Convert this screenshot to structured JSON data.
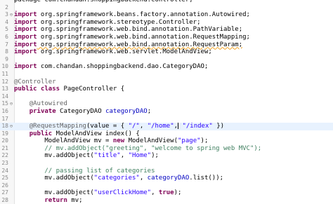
{
  "editor": {
    "lines": [
      {
        "num": "",
        "marker": "",
        "segments": [
          {
            "t": "package com.chandan.shoppingbackend.controller;",
            "k": "plain"
          }
        ]
      },
      {
        "num": "2",
        "marker": "",
        "segments": []
      },
      {
        "num": "3",
        "marker": "⊖",
        "segments": [
          {
            "t": "import",
            "k": "kw"
          },
          {
            "t": " org.springframework.beans.factory.annotation.Autowired;",
            "k": "plain"
          }
        ]
      },
      {
        "num": "4",
        "marker": "",
        "segments": [
          {
            "t": "import",
            "k": "kw"
          },
          {
            "t": " org.springframework.stereotype.Controller;",
            "k": "plain"
          }
        ]
      },
      {
        "num": "5",
        "marker": "",
        "segments": [
          {
            "t": "import",
            "k": "kw"
          },
          {
            "t": " org.springframework.web.bind.annotation.PathVariable;",
            "k": "plain"
          }
        ]
      },
      {
        "num": "6",
        "marker": "",
        "segments": [
          {
            "t": "import",
            "k": "kw"
          },
          {
            "t": " org.springframework.web.bind.annotation.RequestMapping;",
            "k": "plain"
          }
        ]
      },
      {
        "num": "7",
        "marker": "",
        "segments": [
          {
            "t": "import",
            "k": "kw"
          },
          {
            "t": " org.springframework.web.bind.annotation.RequestParam;",
            "k": "warn"
          }
        ]
      },
      {
        "num": "8",
        "marker": "",
        "segments": [
          {
            "t": "import",
            "k": "kw"
          },
          {
            "t": " org.springframework.web.servlet.ModelAndView;",
            "k": "plain"
          }
        ]
      },
      {
        "num": "9",
        "marker": "",
        "segments": []
      },
      {
        "num": "10",
        "marker": "",
        "segments": [
          {
            "t": "import",
            "k": "kw"
          },
          {
            "t": " com.chandan.shoppingbackend.dao.CategoryDAO;",
            "k": "plain"
          }
        ]
      },
      {
        "num": "11",
        "marker": "",
        "segments": []
      },
      {
        "num": "12",
        "marker": "",
        "segments": [
          {
            "t": "@Controller",
            "k": "ann"
          }
        ]
      },
      {
        "num": "13",
        "marker": "",
        "segments": [
          {
            "t": "public",
            "k": "kw"
          },
          {
            "t": " ",
            "k": "plain"
          },
          {
            "t": "class",
            "k": "kw"
          },
          {
            "t": " PageController {",
            "k": "plain"
          }
        ]
      },
      {
        "num": "14",
        "marker": "",
        "segments": []
      },
      {
        "num": "15",
        "marker": "⊖",
        "segments": [
          {
            "t": "    ",
            "k": "plain"
          },
          {
            "t": "@Autowired",
            "k": "ann"
          }
        ]
      },
      {
        "num": "16",
        "marker": "",
        "segments": [
          {
            "t": "    ",
            "k": "plain"
          },
          {
            "t": "private",
            "k": "kw"
          },
          {
            "t": " CategoryDAO ",
            "k": "plain"
          },
          {
            "t": "categoryDAO",
            "k": "fld"
          },
          {
            "t": ";",
            "k": "plain"
          }
        ]
      },
      {
        "num": "17",
        "marker": "",
        "segments": []
      },
      {
        "num": "18",
        "marker": "⊖",
        "current": true,
        "segments": [
          {
            "t": "    ",
            "k": "plain"
          },
          {
            "t": "@RequestMapping",
            "k": "ann"
          },
          {
            "t": "(value = { ",
            "k": "plain"
          },
          {
            "t": "\"/\"",
            "k": "str"
          },
          {
            "t": ", ",
            "k": "plain"
          },
          {
            "t": "\"/home\"",
            "k": "str"
          },
          {
            "t": ",",
            "k": "plain"
          },
          {
            "t": "|",
            "k": "caret"
          },
          {
            "t": " ",
            "k": "plain"
          },
          {
            "t": "\"/index\"",
            "k": "str"
          },
          {
            "t": " })",
            "k": "plain"
          }
        ]
      },
      {
        "num": "19",
        "marker": "",
        "segments": [
          {
            "t": "    ",
            "k": "plain"
          },
          {
            "t": "public",
            "k": "kw"
          },
          {
            "t": " ModelAndView index() {",
            "k": "plain"
          }
        ]
      },
      {
        "num": "20",
        "marker": "",
        "segments": [
          {
            "t": "        ModelAndView mv = ",
            "k": "plain"
          },
          {
            "t": "new",
            "k": "kw"
          },
          {
            "t": " ModelAndView(",
            "k": "plain"
          },
          {
            "t": "\"page\"",
            "k": "str"
          },
          {
            "t": ");",
            "k": "plain"
          }
        ]
      },
      {
        "num": "21",
        "marker": "",
        "segments": [
          {
            "t": "        // mv.addObject(\"greeting\", \"welcome to spring web MVC\");",
            "k": "cmt"
          }
        ]
      },
      {
        "num": "22",
        "marker": "",
        "segments": [
          {
            "t": "        mv.addObject(",
            "k": "plain"
          },
          {
            "t": "\"title\"",
            "k": "str"
          },
          {
            "t": ", ",
            "k": "plain"
          },
          {
            "t": "\"Home\"",
            "k": "str"
          },
          {
            "t": ");",
            "k": "plain"
          }
        ]
      },
      {
        "num": "23",
        "marker": "",
        "segments": []
      },
      {
        "num": "24",
        "marker": "",
        "segments": [
          {
            "t": "        // passing list of categories",
            "k": "cmt"
          }
        ]
      },
      {
        "num": "25",
        "marker": "",
        "segments": [
          {
            "t": "        mv.addObject(",
            "k": "plain"
          },
          {
            "t": "\"categories\"",
            "k": "str"
          },
          {
            "t": ", ",
            "k": "plain"
          },
          {
            "t": "categoryDAO",
            "k": "fld"
          },
          {
            "t": ".list());",
            "k": "plain"
          }
        ]
      },
      {
        "num": "26",
        "marker": "",
        "segments": []
      },
      {
        "num": "27",
        "marker": "",
        "segments": [
          {
            "t": "        mv.addObject(",
            "k": "plain"
          },
          {
            "t": "\"userClickHome\"",
            "k": "str"
          },
          {
            "t": ", ",
            "k": "plain"
          },
          {
            "t": "true",
            "k": "kw"
          },
          {
            "t": ");",
            "k": "plain"
          }
        ]
      },
      {
        "num": "28",
        "marker": "",
        "segments": [
          {
            "t": "        ",
            "k": "plain"
          },
          {
            "t": "return",
            "k": "kw"
          },
          {
            "t": " mv;",
            "k": "plain"
          }
        ]
      },
      {
        "num": "29",
        "marker": "",
        "segments": [
          {
            "t": "    }",
            "k": "plain"
          }
        ]
      }
    ]
  }
}
